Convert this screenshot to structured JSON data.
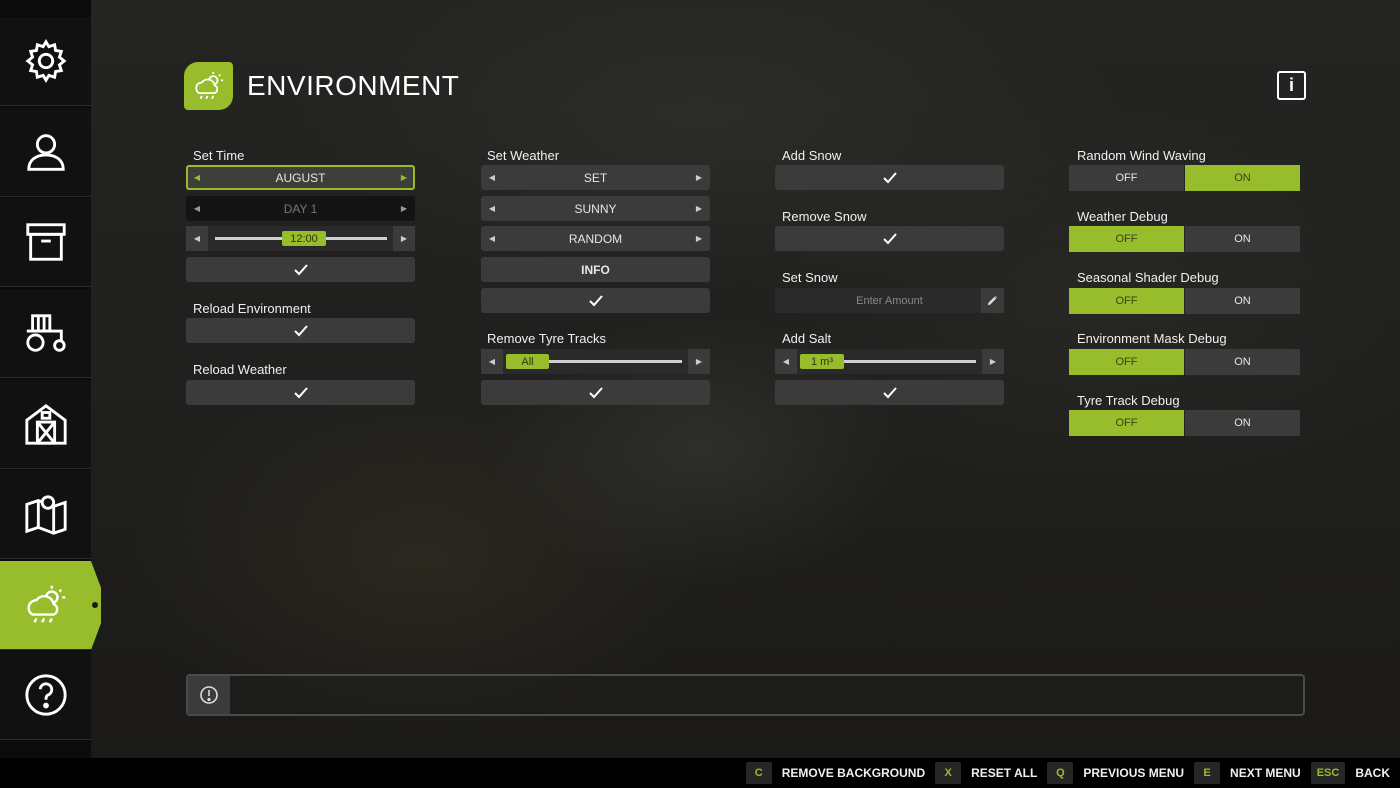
{
  "header": {
    "title": "ENVIRONMENT",
    "info_label": "i"
  },
  "sidebar": {
    "items": [
      {
        "icon": "gear-icon"
      },
      {
        "icon": "user-icon"
      },
      {
        "icon": "archive-box-icon"
      },
      {
        "icon": "tractor-icon"
      },
      {
        "icon": "barn-icon"
      },
      {
        "icon": "map-icon"
      },
      {
        "icon": "weather-icon",
        "active": true
      },
      {
        "icon": "help-icon"
      }
    ]
  },
  "col1": {
    "set_time_label": "Set Time",
    "month": "AUGUST",
    "day": "DAY 1",
    "time": "12:00",
    "reload_env_label": "Reload Environment",
    "reload_weather_label": "Reload Weather"
  },
  "col2": {
    "set_weather_label": "Set Weather",
    "mode": "SET",
    "weather": "SUNNY",
    "variation": "RANDOM",
    "info_button": "INFO",
    "remove_tracks_label": "Remove Tyre Tracks",
    "tracks_value": "All"
  },
  "col3": {
    "add_snow_label": "Add Snow",
    "remove_snow_label": "Remove Snow",
    "set_snow_label": "Set Snow",
    "snow_placeholder": "Enter Amount",
    "add_salt_label": "Add Salt",
    "salt_value": "1 m³"
  },
  "col4": {
    "toggles": [
      {
        "label": "Random Wind Waving",
        "off": "OFF",
        "on": "ON",
        "state": "on"
      },
      {
        "label": "Weather Debug",
        "off": "OFF",
        "on": "ON",
        "state": "off"
      },
      {
        "label": "Seasonal Shader Debug",
        "off": "OFF",
        "on": "ON",
        "state": "off"
      },
      {
        "label": "Environment Mask Debug",
        "off": "OFF",
        "on": "ON",
        "state": "off"
      },
      {
        "label": "Tyre Track Debug",
        "off": "OFF",
        "on": "ON",
        "state": "off"
      }
    ]
  },
  "footer": {
    "buttons": [
      {
        "key": "C",
        "label": "REMOVE BACKGROUND"
      },
      {
        "key": "X",
        "label": "RESET ALL"
      },
      {
        "key": "Q",
        "label": "PREVIOUS MENU"
      },
      {
        "key": "E",
        "label": "NEXT MENU"
      },
      {
        "key": "ESC",
        "label": "BACK"
      }
    ]
  },
  "colors": {
    "accent": "#97bc2c",
    "control_bg": "#3b3b3b"
  }
}
